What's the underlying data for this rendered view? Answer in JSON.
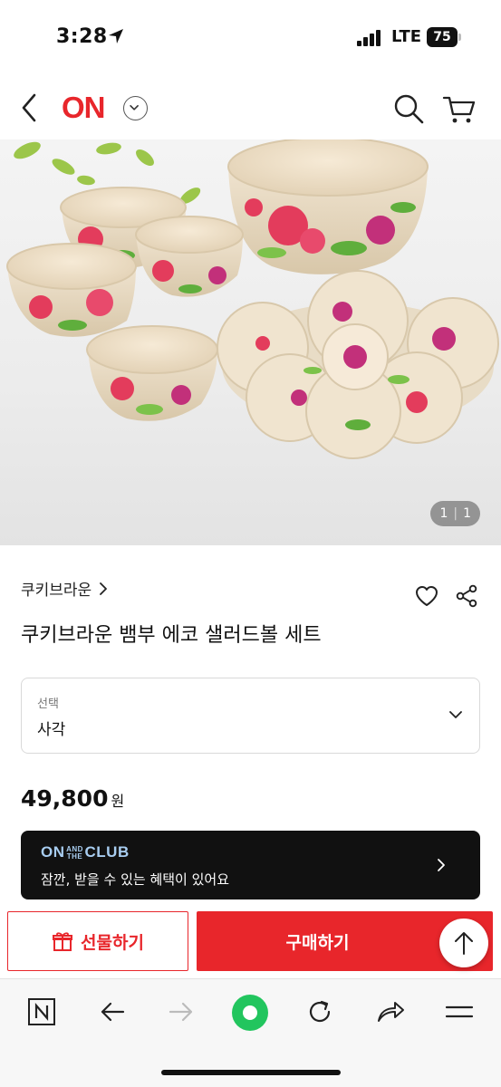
{
  "status_bar": {
    "time": "3:28",
    "network": "LTE",
    "battery": "75"
  },
  "header": {
    "logo": "ON",
    "icons": [
      "back-icon",
      "dropdown-icon",
      "search-icon",
      "cart-icon"
    ]
  },
  "gallery": {
    "current": "1",
    "total": "1"
  },
  "product": {
    "brand": "쿠키브라운",
    "title": "쿠키브라운 뱀부 에코 샐러드볼 세트",
    "option_label": "선택",
    "option_value": "사각",
    "price": "49,800",
    "currency": "원"
  },
  "club_banner": {
    "logo_on": "ON",
    "logo_and_the": "AND THE",
    "logo_club": "CLUB",
    "text": "잠깐, 받을 수 있는 혜택이 있어요"
  },
  "actions": {
    "gift_label": "선물하기",
    "buy_label": "구매하기"
  },
  "colors": {
    "brand_red": "#e8262b",
    "club_blue": "#a8cdf0",
    "dark": "#111111",
    "green_dot": "#22c55e"
  }
}
